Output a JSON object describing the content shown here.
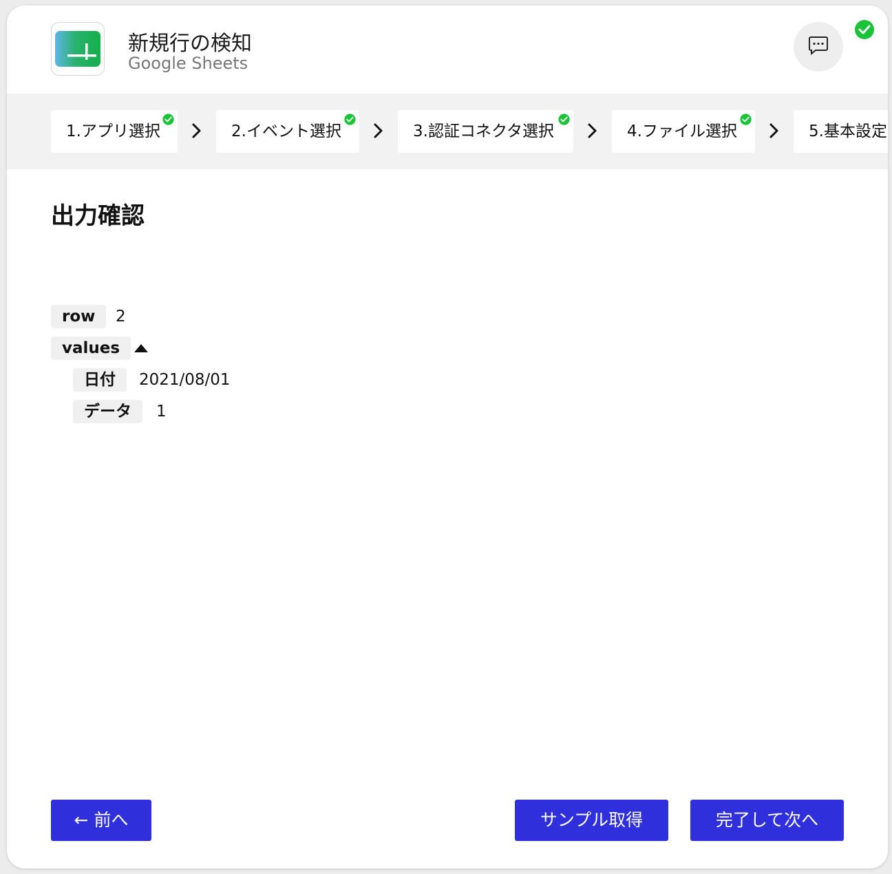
{
  "header": {
    "title": "新規行の検知",
    "subtitle": "Google Sheets",
    "app_icon": "google-sheets-icon",
    "chat_icon": "chat-bubble-icon",
    "status_icon": "check-circle-icon"
  },
  "stepper": {
    "steps": [
      {
        "label": "1.アプリ選択",
        "done": true
      },
      {
        "label": "2.イベント選択",
        "done": true
      },
      {
        "label": "3.認証コネクタ選択",
        "done": true
      },
      {
        "label": "4.ファイル選択",
        "done": true
      },
      {
        "label": "5.基本設定",
        "done": false
      }
    ],
    "separator_icon": "chevron-right-icon"
  },
  "main": {
    "section_title": "出力確認",
    "output": {
      "row_key": "row",
      "row_value": "2",
      "values_key": "values",
      "values_toggle_icon": "caret-up-icon",
      "fields": [
        {
          "key": "日付",
          "value": "2021/08/01"
        },
        {
          "key": "データ",
          "value": "1"
        }
      ]
    }
  },
  "footer": {
    "prev_label": "← 前へ",
    "sample_label": "サンプル取得",
    "next_label": "完了して次へ"
  },
  "colors": {
    "primary_button": "#2f2fdc",
    "success_green": "#1bc33a",
    "stepper_bg": "#f2f2f2"
  }
}
